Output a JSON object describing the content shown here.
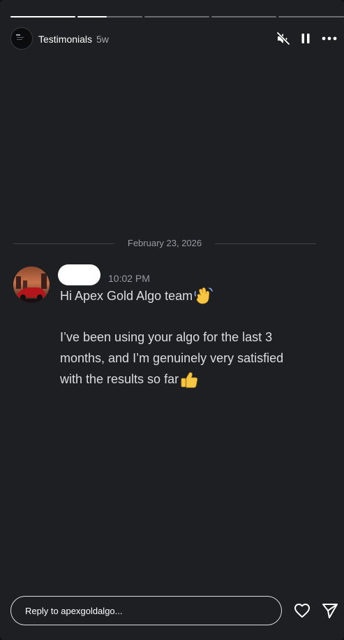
{
  "story": {
    "account": "Testimonials",
    "age": "5w",
    "progress_segments": [
      1,
      0.45,
      0,
      0,
      0
    ]
  },
  "controls": {
    "mute_icon": "speaker-muted-icon",
    "pause_icon": "pause-icon",
    "more_icon": "more-options-icon"
  },
  "message": {
    "date": "February 23, 2026",
    "time": "10:02 PM",
    "lines": [
      "Hi Apex Gold Algo team",
      "I’ve been using your algo for the last 3",
      "months, and I’m genuinely very satisfied",
      "with the results so far"
    ],
    "emojis": [
      "waving-hand-icon",
      "thumbs-up-icon"
    ]
  },
  "reply": {
    "placeholder": "Reply to apexgoldalgo..."
  },
  "actions": {
    "like_icon": "heart-icon",
    "share_icon": "send-icon"
  }
}
